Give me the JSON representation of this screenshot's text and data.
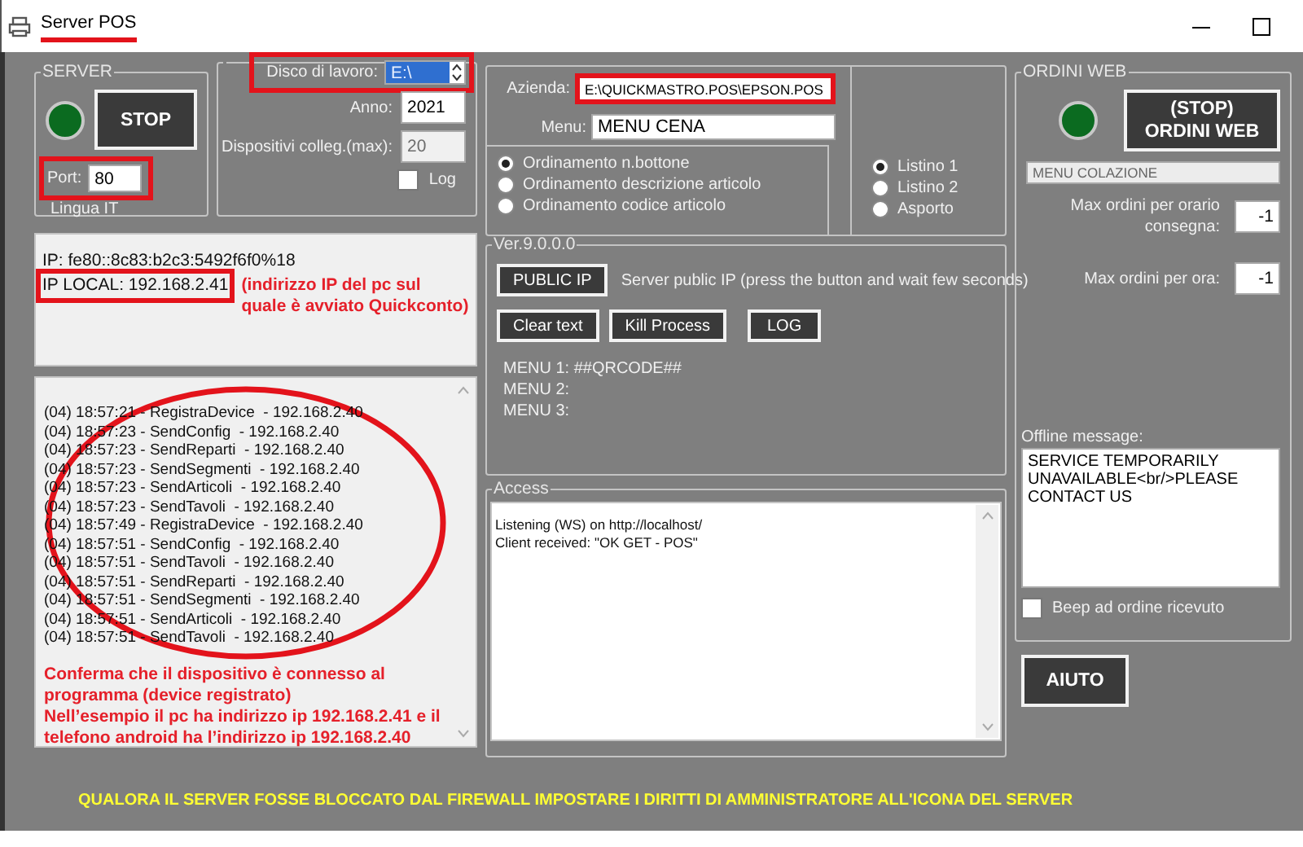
{
  "window": {
    "title": "Server POS",
    "title_marked": true
  },
  "server": {
    "legend": "SERVER",
    "running": true,
    "button": "STOP",
    "port_label": "Port:",
    "port": "80",
    "port_marked": true,
    "language": "Lingua IT"
  },
  "workspace": {
    "disk_label": "Disco di lavoro:",
    "disk": "E:\\",
    "disk_marked": true,
    "year_label": "Anno:",
    "year": "2021",
    "devices_label": "Dispositivi colleg.(max):",
    "devices": "20",
    "log": {
      "label": "Log",
      "checked": false
    }
  },
  "company": {
    "company_label": "Azienda:",
    "company": "E:\\QUICKMASTRO.POS\\EPSON.POS",
    "company_marked": true,
    "menu_label": "Menu:",
    "menu": "MENU CENA",
    "sort_options": [
      {
        "label": "Ordinamento n.bottone",
        "selected": true
      },
      {
        "label": "Ordinamento descrizione articolo",
        "selected": false
      },
      {
        "label": "Ordinamento codice articolo",
        "selected": false
      }
    ],
    "price_lists": [
      {
        "label": "Listino 1",
        "selected": true
      },
      {
        "label": "Listino 2",
        "selected": false
      },
      {
        "label": "Asporto",
        "selected": false
      }
    ]
  },
  "ip_info": {
    "lines": [
      {
        "text": "IP: fe80::8c83:b2c3:5492f6f0%18",
        "marked": false
      },
      {
        "text": "IP LOCAL: 192.168.2.41",
        "marked": true
      }
    ],
    "note": "(indirizzo IP del pc sul quale è avviato Quickconto)"
  },
  "version_panel": {
    "legend": "Ver.9.0.0.0",
    "public_ip_button": "PUBLIC IP",
    "public_ip_note": "Server public IP (press the button and wait few seconds)",
    "buttons": [
      "Clear text",
      "Kill Process",
      "LOG"
    ],
    "menus": [
      "MENU 1: ##QRCODE##",
      "MENU 2:",
      "MENU 3:"
    ]
  },
  "log": {
    "circled": true,
    "lines": [
      "(04) 18:57:21 - RegistraDevice  - 192.168.2.40",
      "(04) 18:57:23 - SendConfig  - 192.168.2.40",
      "(04) 18:57:23 - SendReparti  - 192.168.2.40",
      "(04) 18:57:23 - SendSegmenti  - 192.168.2.40",
      "(04) 18:57:23 - SendArticoli  - 192.168.2.40",
      "(04) 18:57:23 - SendTavoli  - 192.168.2.40",
      "(04) 18:57:49 - RegistraDevice  - 192.168.2.40",
      "(04) 18:57:51 - SendConfig  - 192.168.2.40",
      "(04) 18:57:51 - SendTavoli  - 192.168.2.40",
      "(04) 18:57:51 - SendReparti  - 192.168.2.40",
      "(04) 18:57:51 - SendSegmenti  - 192.168.2.40",
      "(04) 18:57:51 - SendArticoli  - 192.168.2.40",
      "(04) 18:57:51 - SendTavoli  - 192.168.2.40"
    ],
    "note": [
      "Conferma che il dispositivo è connesso al programma (device registrato)",
      "Nell’esempio il pc ha indirizzo ip 192.168.2.41 e il telefono android ha l’indirizzo ip 192.168.2.40"
    ]
  },
  "access": {
    "legend": "Access",
    "lines": [
      "Listening (WS) on http://localhost/",
      "Client received: \"OK GET - POS\""
    ]
  },
  "web_orders": {
    "legend": "ORDINI WEB",
    "running": true,
    "button": "(STOP) ORDINI WEB",
    "menu": "MENU COLAZIONE",
    "max_per_slot_label": "Max ordini per orario consegna:",
    "max_per_slot": "-1",
    "max_per_hour_label": "Max ordini per ora:",
    "max_per_hour": "-1",
    "offline_label": "Offline message:",
    "offline_message": "SERVICE TEMPORARILY UNAVAILABLE<br/>PLEASE CONTACT US",
    "beep": {
      "label": "Beep ad ordine ricevuto",
      "checked": false
    }
  },
  "help_button": "AIUTO",
  "footer_notice": "QUALORA IL SERVER FOSSE BLOCCATO DAL FIREWALL IMPOSTARE I DIRITTI DI AMMINISTRATORE ALL'ICONA DEL SERVER"
}
